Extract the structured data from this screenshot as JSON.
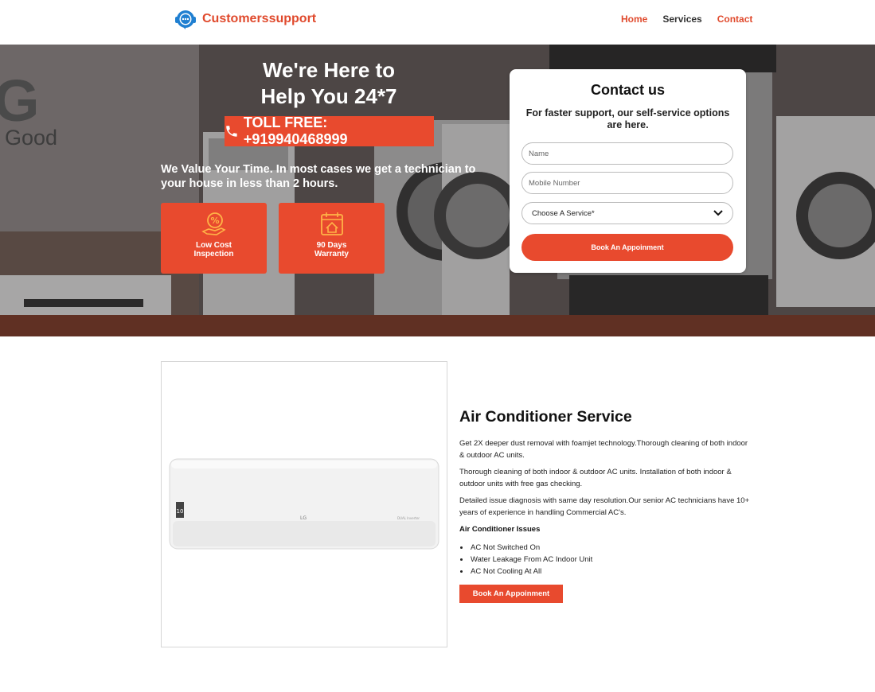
{
  "header": {
    "brand": "Customerssupport",
    "nav": [
      {
        "label": "Home"
      },
      {
        "label": "Services"
      },
      {
        "label": "Contact"
      }
    ]
  },
  "hero": {
    "bg_brand_letter": "G",
    "bg_brand_word": "Good",
    "title_line1": "We're Here to",
    "title_line2": "Help You 24*7",
    "toll_free": "TOLL FREE: +919940468999",
    "subtitle": "We Value Your Time. In most cases we get a technician to your house in less than 2 hours.",
    "features": [
      {
        "label_line1": "Low Cost",
        "label_line2": "Inspection",
        "icon": "rupee-hand-icon"
      },
      {
        "label_line1": "90 Days",
        "label_line2": "Warranty",
        "icon": "calendar-home-icon"
      }
    ]
  },
  "contact": {
    "title": "Contact us",
    "subtitle": "For faster support, our self-service options are here.",
    "name_placeholder": "Name",
    "mobile_placeholder": "Mobile Number",
    "service_select": "Choose A Service*",
    "button": "Book An Appoinment"
  },
  "service": {
    "title": "Air Conditioner Service",
    "para1": "Get 2X deeper dust removal with foamjet technology.Thorough cleaning of both indoor & outdoor AC units.",
    "para2": "Thorough cleaning of both indoor & outdoor AC units. Installation of both indoor & outdoor units with free gas checking.",
    "para3": "Detailed issue diagnosis with same day resolution.Our senior AC technicians have 10+ years of experience in handling Commercial AC's.",
    "issues_heading": "Air Conditioner Issues",
    "issues": [
      "AC Not Switched On",
      "Water Leakage From AC Indoor Unit",
      "AC Not Cooling At All"
    ],
    "button": "Book An Appoinment",
    "ac_brand": "LG",
    "ac_badge": "10",
    "ac_model": "DUAL Inverter"
  },
  "colors": {
    "accent": "#e84a2e",
    "brand": "#e04a2d",
    "logo_blue": "#1f7fd1"
  }
}
